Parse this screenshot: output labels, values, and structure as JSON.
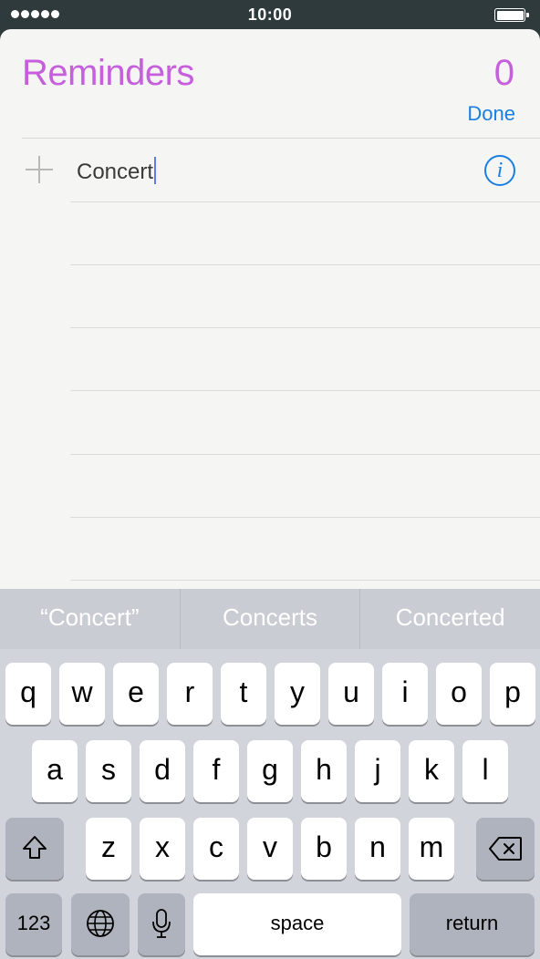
{
  "status_bar": {
    "time": "10:00"
  },
  "header": {
    "title": "Reminders",
    "count": "0",
    "done_label": "Done"
  },
  "reminder": {
    "text": "Concert"
  },
  "suggestions": [
    "“Concert”",
    "Concerts",
    "Concerted"
  ],
  "keyboard": {
    "row1": [
      "q",
      "w",
      "e",
      "r",
      "t",
      "y",
      "u",
      "i",
      "o",
      "p"
    ],
    "row2": [
      "a",
      "s",
      "d",
      "f",
      "g",
      "h",
      "j",
      "k",
      "l"
    ],
    "row3": [
      "z",
      "x",
      "c",
      "v",
      "b",
      "n",
      "m"
    ],
    "numbers_label": "123",
    "space_label": "space",
    "return_label": "return"
  },
  "icons": {
    "shift": "shift-arrow-icon",
    "delete": "backspace-icon",
    "globe": "globe-icon",
    "mic": "microphone-icon",
    "info": "info-circle-icon",
    "add": "plus-icon"
  },
  "colors": {
    "title": "#c65fdc",
    "accent": "#1a7fe0"
  }
}
